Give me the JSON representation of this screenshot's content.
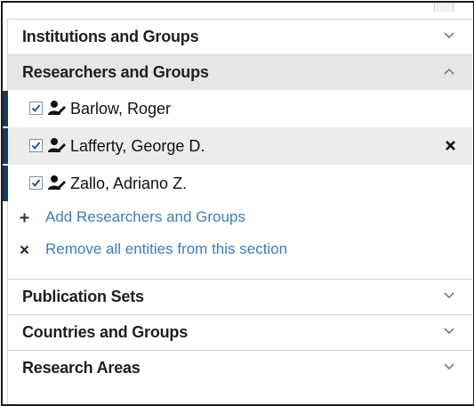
{
  "sections": {
    "institutions": {
      "title": "Institutions and Groups",
      "chevron_icon": "chevron-down-icon"
    },
    "researchers": {
      "title": "Researchers and Groups",
      "chevron_icon": "chevron-up-icon",
      "entities": [
        {
          "name": "Barlow, Roger",
          "checked": true,
          "icon": "person-group-icon"
        },
        {
          "name": "Lafferty, George D.",
          "checked": true,
          "icon": "person-group-icon",
          "remove_icon": "close-icon"
        },
        {
          "name": "Zallo, Adriano Z.",
          "checked": true,
          "icon": "person-group-icon"
        }
      ],
      "add_label": "Add Researchers and Groups",
      "remove_all_label": "Remove all entities from this section"
    },
    "publication_sets": {
      "title": "Publication Sets",
      "chevron_icon": "chevron-down-icon"
    },
    "countries": {
      "title": "Countries and Groups",
      "chevron_icon": "chevron-down-icon"
    },
    "research_areas": {
      "title": "Research Areas",
      "chevron_icon": "chevron-down-icon"
    }
  },
  "colors": {
    "accent_bar": "#163a5c",
    "link": "#3a7fbf",
    "expanded_header_bg": "#e6e6e6",
    "hover_row_bg": "#ececec"
  }
}
